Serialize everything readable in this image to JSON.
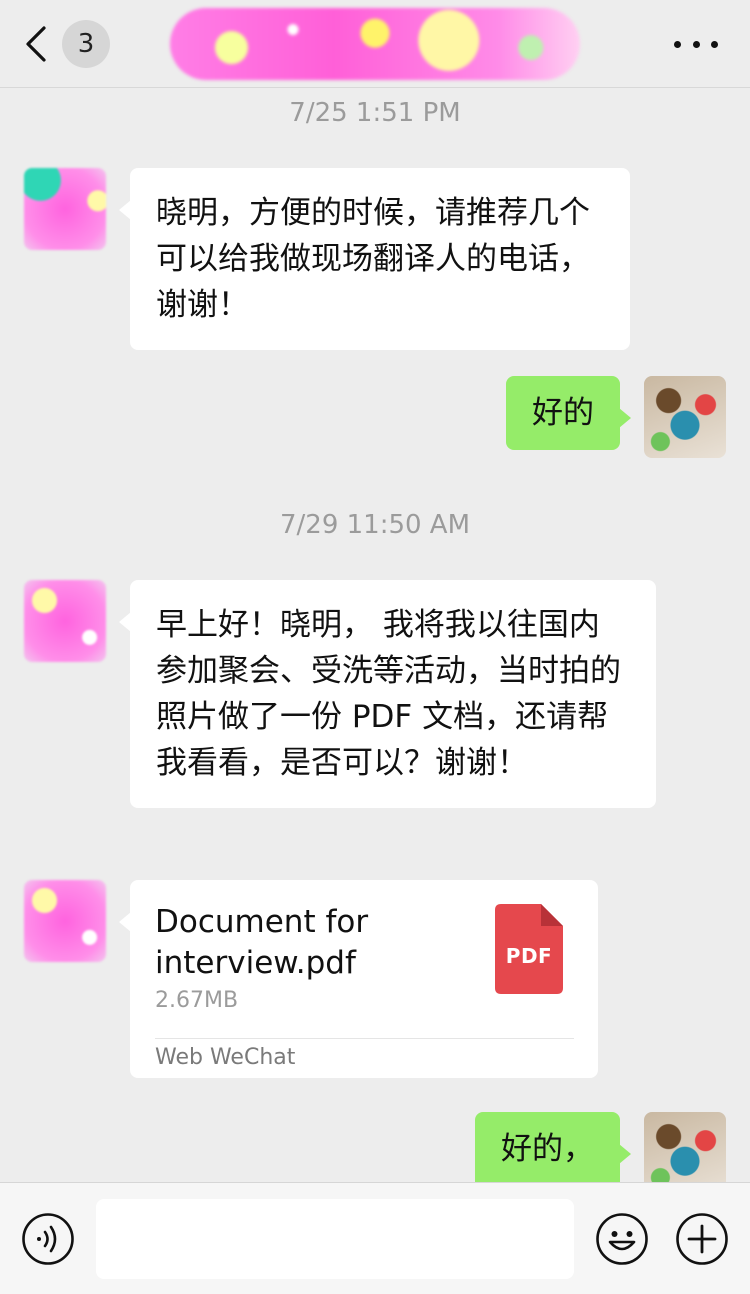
{
  "header": {
    "unread_count": "3",
    "back_icon": "chevron-left-icon",
    "more_icon": "more-dots-icon"
  },
  "messages": [
    {
      "type": "timestamp",
      "text": "7/25 1:51 PM"
    },
    {
      "type": "text",
      "from": "peer",
      "text": "晓明，方便的时候，请推荐几个可以给我做现场翻译人的电话，谢谢！"
    },
    {
      "type": "text",
      "from": "self",
      "text": "好的"
    },
    {
      "type": "timestamp",
      "text": "7/29 11:50 AM"
    },
    {
      "type": "text",
      "from": "peer",
      "text": "早上好！晓明， 我将我以往国内参加聚会、受洗等活动，当时拍的照片做了一份 PDF 文档，还请帮我看看，是否可以？谢谢！"
    },
    {
      "type": "file",
      "from": "peer",
      "file_name": "Document for interview.pdf",
      "file_size": "2.67MB",
      "file_type": "PDF",
      "source": "Web WeChat"
    },
    {
      "type": "text",
      "from": "self",
      "text": "好的，"
    }
  ],
  "input_bar": {
    "voice_icon": "voice-icon",
    "emoji_icon": "emoji-icon",
    "plus_icon": "plus-icon",
    "placeholder": ""
  },
  "colors": {
    "background": "#ededed",
    "self_bubble": "#95ec69",
    "peer_bubble": "#ffffff",
    "pdf_icon": "#e5484d",
    "timestamp": "#9b9b9b"
  }
}
